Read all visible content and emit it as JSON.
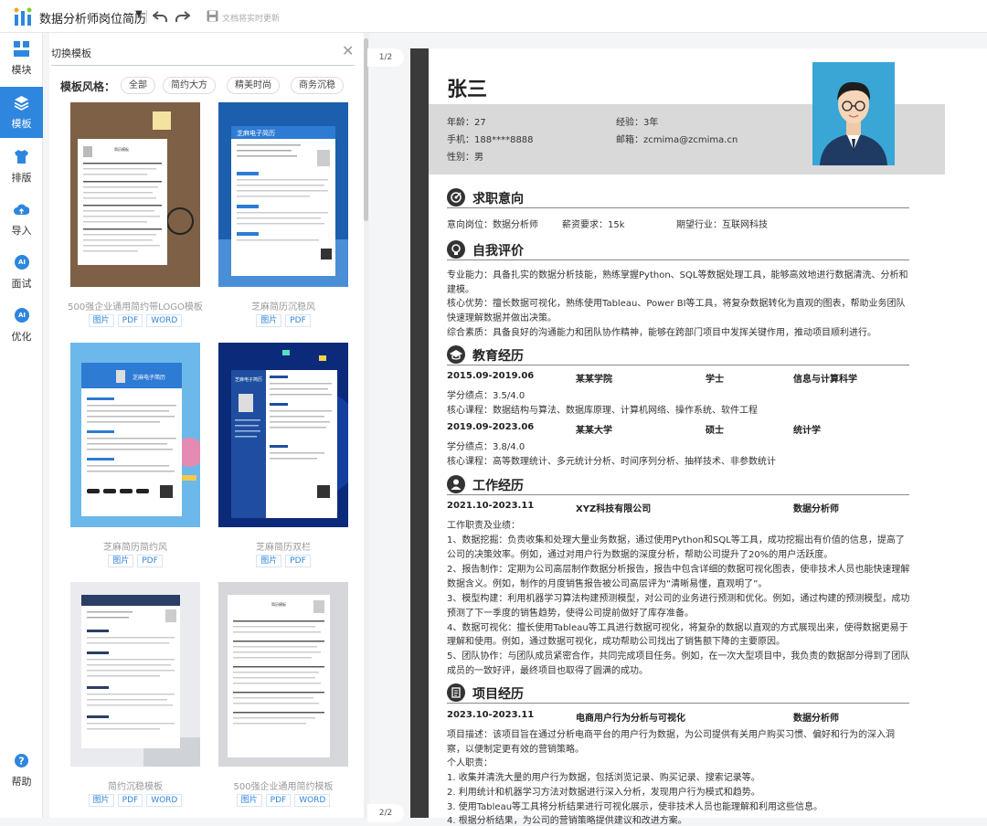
{
  "app": {
    "doc_title": "数据分析师岗位简历",
    "save_status": "文档将实时更新"
  },
  "nav": [
    {
      "label": "模块"
    },
    {
      "label": "模板"
    },
    {
      "label": "排版"
    },
    {
      "label": "导入"
    },
    {
      "label": "面试",
      "badge": "AI"
    },
    {
      "label": "优化",
      "badge": "AI"
    },
    {
      "label": "帮助"
    }
  ],
  "panel": {
    "title": "切换模板",
    "filter_label": "模板风格：",
    "filters": [
      "全部",
      "简约大方",
      "精美时尚",
      "商务沉稳"
    ],
    "templates": [
      {
        "name": "500强企业通用简约带LOGO模板",
        "tags": [
          "图片",
          "PDF",
          "WORD"
        ],
        "thumb_title": "简历模板"
      },
      {
        "name": "芝麻简历沉稳风",
        "tags": [
          "图片",
          "PDF"
        ],
        "thumb_title": "芝麻电子简历"
      },
      {
        "name": "芝麻简历简约风",
        "tags": [
          "图片",
          "PDF"
        ],
        "thumb_title": "芝麻电子简历"
      },
      {
        "name": "芝麻简历双栏",
        "tags": [
          "图片",
          "PDF"
        ],
        "thumb_title": "芝麻电子简历"
      },
      {
        "name": "简约沉稳模板",
        "tags": [
          "图片",
          "PDF",
          "WORD"
        ]
      },
      {
        "name": "500强企业通用简约模板",
        "tags": [
          "图片",
          "PDF",
          "WORD"
        ],
        "thumb_title": "简历模板"
      }
    ]
  },
  "pager": {
    "page1": "1/2",
    "page2": "2/2"
  },
  "resume": {
    "name": "张三",
    "info": {
      "age": "年龄：27",
      "experience": "经验：3年",
      "phone": "手机：188****8888",
      "email": "邮箱：zcmima@zcmima.cn",
      "gender": "性别：男"
    },
    "sections": {
      "intent": "求职意向",
      "self": "自我评价",
      "edu": "教育经历",
      "work": "工作经历",
      "project": "项目经历"
    },
    "intent": {
      "position": "意向岗位：数据分析师",
      "salary": "薪资要求：15k",
      "industry": "期望行业：互联网科技"
    },
    "self": {
      "l1": "专业能力：具备扎实的数据分析技能，熟练掌握Python、SQL等数据处理工具，能够高效地进行数据清洗、分析和",
      "l2": "建模。",
      "l3": "核心优势：擅长数据可视化，熟练使用Tableau、Power BI等工具，将复杂数据转化为直观的图表，帮助业务团队",
      "l4": "快速理解数据并做出决策。",
      "l5": "综合素质：具备良好的沟通能力和团队协作精神，能够在跨部门项目中发挥关键作用，推动项目顺利进行。"
    },
    "edu": [
      {
        "period": "2015.09-2019.06",
        "school": "某某学院",
        "degree": "学士",
        "major": "信息与计算科学",
        "gpa": "学分绩点：3.5/4.0",
        "courses": "核心课程：数据结构与算法、数据库原理、计算机网络、操作系统、软件工程"
      },
      {
        "period": "2019.09-2023.06",
        "school": "某某大学",
        "degree": "硕士",
        "major": "统计学",
        "gpa": "学分绩点：3.8/4.0",
        "courses": "核心课程：高等数理统计、多元统计分析、时间序列分析、抽样技术、非参数统计"
      }
    ],
    "work": {
      "period": "2021.10-2023.11",
      "company": "XYZ科技有限公司",
      "role": "数据分析师",
      "lines": [
        "工作职责及业绩：",
        "1、数据挖掘：负责收集和处理大量业务数据，通过使用Python和SQL等工具，成功挖掘出有价值的信息，提高了",
        "公司的决策效率。例如，通过对用户行为数据的深度分析，帮助公司提升了20%的用户活跃度。",
        "2、报告制作：定期为公司高层制作数据分析报告，报告中包含详细的数据可视化图表，使非技术人员也能快速理解",
        "数据含义。例如，制作的月度销售报告被公司高层评为“清晰易懂，直观明了”。",
        "3、模型构建：利用机器学习算法构建预测模型，对公司的业务进行预测和优化。例如，通过构建的预测模型，成功",
        "预测了下一季度的销售趋势，使得公司提前做好了库存准备。",
        "4、数据可视化：擅长使用Tableau等工具进行数据可视化，将复杂的数据以直观的方式展现出来，使得数据更易于",
        "理解和使用。例如，通过数据可视化，成功帮助公司找出了销售额下降的主要原因。",
        "5、团队协作：与团队成员紧密合作，共同完成项目任务。例如，在一次大型项目中，我负责的数据部分得到了团队",
        "成员的一致好评，最终项目也取得了圆满的成功。"
      ]
    },
    "project": {
      "period": "2023.10-2023.11",
      "name": "电商用户行为分析与可视化",
      "role": "数据分析师",
      "lines": [
        "项目描述：该项目旨在通过分析电商平台的用户行为数据，为公司提供有关用户购买习惯、偏好和行为的深入洞",
        "察，以便制定更有效的营销策略。",
        "个人职责：",
        "1. 收集并清洗大量的用户行为数据，包括浏览记录、购买记录、搜索记录等。",
        "2. 利用统计和机器学习方法对数据进行深入分析，发现用户行为模式和趋势。",
        "3. 使用Tableau等工具将分析结果进行可视化展示，使非技术人员也能理解和利用这些信息。",
        "4. 根据分析结果，为公司的营销策略提供建议和改进方案。"
      ]
    }
  }
}
